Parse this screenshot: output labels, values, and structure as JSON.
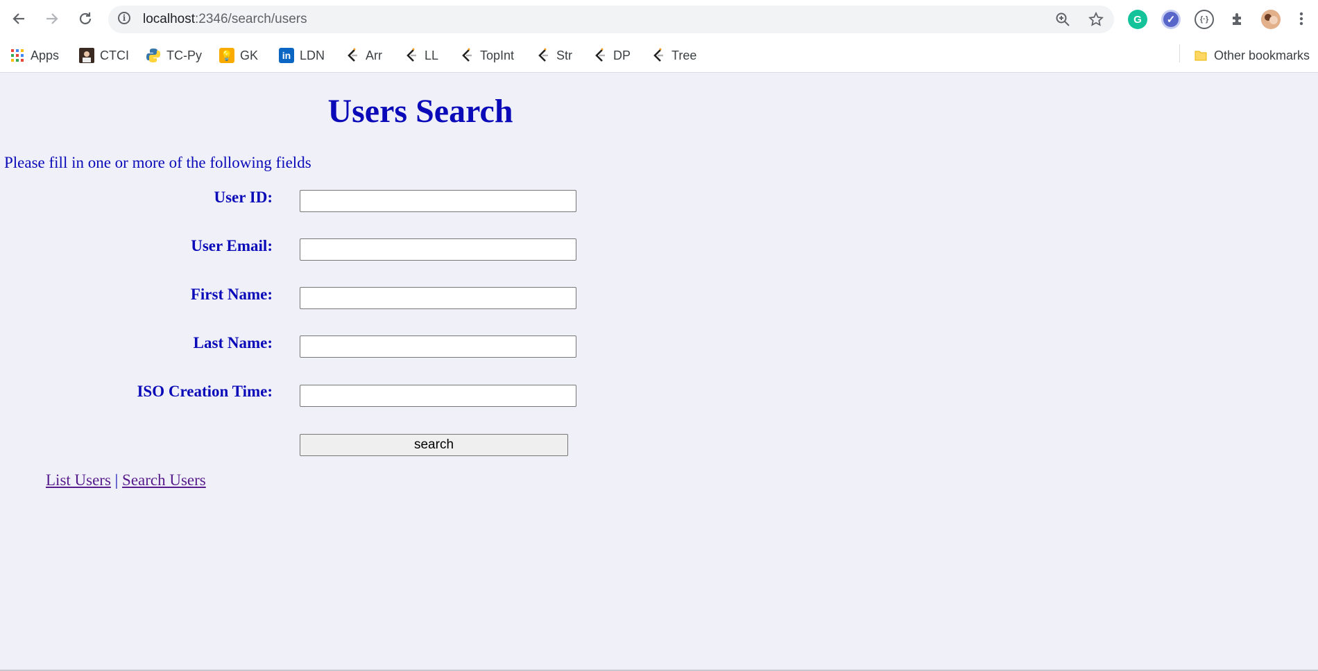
{
  "browser": {
    "url_host": "localhost",
    "url_rest": ":2346/search/users",
    "bookmarks": [
      {
        "label": "Apps",
        "icon": "apps-grid-icon"
      },
      {
        "label": "CTCI",
        "icon": "avatar-photo-icon"
      },
      {
        "label": "TC-Py",
        "icon": "python-icon"
      },
      {
        "label": "GK",
        "icon": "lightbulb-icon"
      },
      {
        "label": "LDN",
        "icon": "linkedin-icon"
      },
      {
        "label": "Arr",
        "icon": "leetcode-icon"
      },
      {
        "label": "LL",
        "icon": "leetcode-icon"
      },
      {
        "label": "TopInt",
        "icon": "leetcode-icon"
      },
      {
        "label": "Str",
        "icon": "leetcode-icon"
      },
      {
        "label": "DP",
        "icon": "leetcode-icon"
      },
      {
        "label": "Tree",
        "icon": "leetcode-icon"
      }
    ],
    "other_bookmarks": "Other bookmarks",
    "extension_grammarly_glyph": "G"
  },
  "page": {
    "title": "Users Search",
    "instructions": "Please fill in one or more of the following fields",
    "fields": [
      {
        "label": "User ID:",
        "value": ""
      },
      {
        "label": "User Email:",
        "value": ""
      },
      {
        "label": "First Name:",
        "value": ""
      },
      {
        "label": "Last Name:",
        "value": ""
      },
      {
        "label": "ISO Creation Time:",
        "value": ""
      }
    ],
    "search_button": "search",
    "links": {
      "list_users": "List Users",
      "separator": "|",
      "search_users": "Search Users"
    }
  },
  "colors": {
    "page_bg": "#f0f0f8",
    "heading": "#0a0ab8",
    "visited_link": "#551a8b"
  }
}
